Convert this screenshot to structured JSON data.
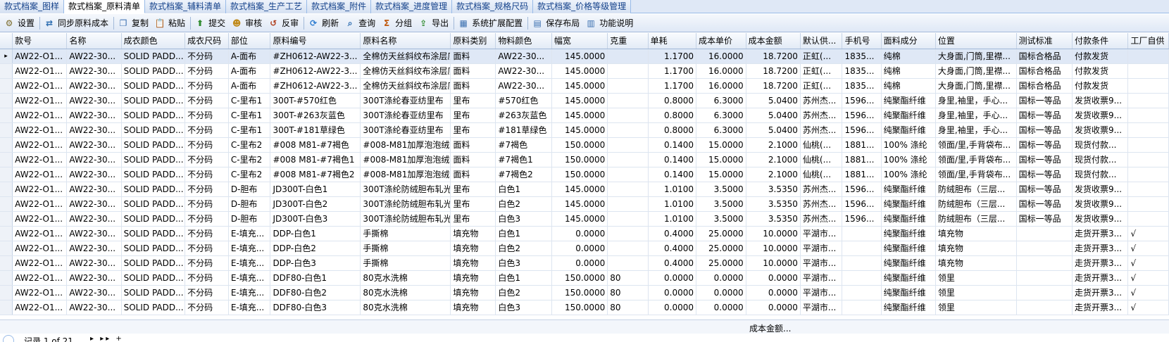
{
  "tabs": [
    {
      "label": "款式档案_图样",
      "active": false
    },
    {
      "label": "款式档案_原料清单",
      "active": true
    },
    {
      "label": "款式档案_辅料清单",
      "active": false
    },
    {
      "label": "款式档案_生产工艺",
      "active": false
    },
    {
      "label": "款式档案_附件",
      "active": false
    },
    {
      "label": "款式档案_进度管理",
      "active": false
    },
    {
      "label": "款式档案_规格尺码",
      "active": false
    },
    {
      "label": "款式档案_价格等级管理",
      "active": false
    }
  ],
  "toolbar": [
    {
      "label": "设置",
      "icon": "settings-icon",
      "glyph": "⚙",
      "color": "#7a6a2a"
    },
    {
      "label": "同步原料成本",
      "icon": "sync-cost-icon",
      "glyph": "⇄",
      "color": "#2b6cb0"
    },
    {
      "label": "复制",
      "icon": "copy-icon",
      "glyph": "❐",
      "color": "#3a6fb0"
    },
    {
      "label": "粘贴",
      "icon": "paste-icon",
      "glyph": "📋",
      "color": "#8a6d2b"
    },
    {
      "label": "提交",
      "icon": "submit-icon",
      "glyph": "⬆",
      "color": "#2f8a2f"
    },
    {
      "label": "审核",
      "icon": "approve-user-icon",
      "glyph": "☻",
      "color": "#c08a1a"
    },
    {
      "label": "反审",
      "icon": "unapprove-icon",
      "glyph": "↺",
      "color": "#b04020"
    },
    {
      "label": "刷新",
      "icon": "refresh-icon",
      "glyph": "⟳",
      "color": "#2b7bd0"
    },
    {
      "label": "查询",
      "icon": "search-icon",
      "glyph": "⌕",
      "color": "#2b6cb0"
    },
    {
      "label": "分组",
      "icon": "group-sigma-icon",
      "glyph": "Σ",
      "color": "#c05a10"
    },
    {
      "label": "导出",
      "icon": "export-icon",
      "glyph": "⇪",
      "color": "#2f8a2f"
    },
    {
      "label": "系统扩展配置",
      "icon": "extension-config-icon",
      "glyph": "▦",
      "color": "#3a6fb0"
    },
    {
      "label": "保存布局",
      "icon": "save-layout-icon",
      "glyph": "▤",
      "color": "#3a6fb0"
    },
    {
      "label": "功能说明",
      "icon": "help-doc-icon",
      "glyph": "▥",
      "color": "#3a6fb0"
    }
  ],
  "columns": [
    "款号",
    "名称",
    "成衣颜色",
    "成衣尺码",
    "部位",
    "原料编号",
    "原料名称",
    "原料类别",
    "物料颜色",
    "幅宽",
    "克重",
    "单耗",
    "成本单价",
    "成本金额",
    "默认供...",
    "手机号",
    "面料成分",
    "位置",
    "测试标准",
    "付款条件",
    "工厂自供"
  ],
  "rows": [
    [
      "AW22-O1...",
      "AW22-30...",
      "SOLID PADD...",
      "不分码",
      "A-面布",
      "#ZH0612-AW22-3...",
      "全棉仿天丝斜纹布涂层底",
      "面料",
      "AW22-30...",
      "145.0000",
      "",
      "1.1700",
      "16.0000",
      "18.7200",
      "正虹(...",
      "1835...",
      "纯棉",
      "大身面,门筒,里襟...",
      "国标合格品",
      "付款发货",
      ""
    ],
    [
      "AW22-O1...",
      "AW22-30...",
      "SOLID PADD...",
      "不分码",
      "A-面布",
      "#ZH0612-AW22-3...",
      "全棉仿天丝斜纹布涂层底",
      "面料",
      "AW22-30...",
      "145.0000",
      "",
      "1.1700",
      "16.0000",
      "18.7200",
      "正虹(...",
      "1835...",
      "纯棉",
      "大身面,门筒,里襟...",
      "国标合格品",
      "付款发货",
      ""
    ],
    [
      "AW22-O1...",
      "AW22-30...",
      "SOLID PADD...",
      "不分码",
      "A-面布",
      "#ZH0612-AW22-3...",
      "全棉仿天丝斜纹布涂层底",
      "面料",
      "AW22-30...",
      "145.0000",
      "",
      "1.1700",
      "16.0000",
      "18.7200",
      "正虹(...",
      "1835...",
      "纯棉",
      "大身面,门筒,里襟...",
      "国标合格品",
      "付款发货",
      ""
    ],
    [
      "AW22-O1...",
      "AW22-30...",
      "SOLID PADD...",
      "不分码",
      "C-里布1",
      "300T-#570红色",
      "300T涤纶春亚纺里布",
      "里布",
      "#570红色",
      "145.0000",
      "",
      "0.8000",
      "6.3000",
      "5.0400",
      "苏州杰...",
      "1596...",
      "纯聚酯纤维",
      "身里,袖里，手心...",
      "国标一等品",
      "发货收票9...",
      ""
    ],
    [
      "AW22-O1...",
      "AW22-30...",
      "SOLID PADD...",
      "不分码",
      "C-里布1",
      "300T-#263灰蓝色",
      "300T涤纶春亚纺里布",
      "里布",
      "#263灰蓝色",
      "145.0000",
      "",
      "0.8000",
      "6.3000",
      "5.0400",
      "苏州杰...",
      "1596...",
      "纯聚酯纤维",
      "身里,袖里，手心...",
      "国标一等品",
      "发货收票9...",
      ""
    ],
    [
      "AW22-O1...",
      "AW22-30...",
      "SOLID PADD...",
      "不分码",
      "C-里布1",
      "300T-#181草绿色",
      "300T涤纶春亚纺里布",
      "里布",
      "#181草绿色",
      "145.0000",
      "",
      "0.8000",
      "6.3000",
      "5.0400",
      "苏州杰...",
      "1596...",
      "纯聚酯纤维",
      "身里,袖里，手心...",
      "国标一等品",
      "发货收票9...",
      ""
    ],
    [
      "AW22-O1...",
      "AW22-30...",
      "SOLID PADD...",
      "不分码",
      "C-里布2",
      "#008 M81-#7褐色",
      "#008-M81加厚泡泡绒",
      "面料",
      "#7褐色",
      "150.0000",
      "",
      "0.1400",
      "15.0000",
      "2.1000",
      "仙桃(...",
      "1881...",
      "100% 涤纶",
      "领面/里,手背袋布...",
      "国标一等品",
      "现货付款...",
      ""
    ],
    [
      "AW22-O1...",
      "AW22-30...",
      "SOLID PADD...",
      "不分码",
      "C-里布2",
      "#008 M81-#7褐色1",
      "#008-M81加厚泡泡绒",
      "面料",
      "#7褐色1",
      "150.0000",
      "",
      "0.1400",
      "15.0000",
      "2.1000",
      "仙桃(...",
      "1881...",
      "100% 涤纶",
      "领面/里,手背袋布...",
      "国标一等品",
      "现货付款...",
      ""
    ],
    [
      "AW22-O1...",
      "AW22-30...",
      "SOLID PADD...",
      "不分码",
      "C-里布2",
      "#008 M81-#7褐色2",
      "#008-M81加厚泡泡绒",
      "面料",
      "#7褐色2",
      "150.0000",
      "",
      "0.1400",
      "15.0000",
      "2.1000",
      "仙桃(...",
      "1881...",
      "100% 涤纶",
      "领面/里,手背袋布...",
      "国标一等品",
      "现货付款...",
      ""
    ],
    [
      "AW22-O1...",
      "AW22-30...",
      "SOLID PADD...",
      "不分码",
      "D-胆布",
      "JD300T-白色1",
      "300T涤纶防绒胆布轧光底",
      "里布",
      "白色1",
      "145.0000",
      "",
      "1.0100",
      "3.5000",
      "3.5350",
      "苏州杰...",
      "1596...",
      "纯聚酯纤维",
      "防绒胆布（三层...",
      "国标一等品",
      "发货收票9...",
      ""
    ],
    [
      "AW22-O1...",
      "AW22-30...",
      "SOLID PADD...",
      "不分码",
      "D-胆布",
      "JD300T-白色2",
      "300T涤纶防绒胆布轧光底",
      "里布",
      "白色2",
      "145.0000",
      "",
      "1.0100",
      "3.5000",
      "3.5350",
      "苏州杰...",
      "1596...",
      "纯聚酯纤维",
      "防绒胆布（三层...",
      "国标一等品",
      "发货收票9...",
      ""
    ],
    [
      "AW22-O1...",
      "AW22-30...",
      "SOLID PADD...",
      "不分码",
      "D-胆布",
      "JD300T-白色3",
      "300T涤纶防绒胆布轧光底",
      "里布",
      "白色3",
      "145.0000",
      "",
      "1.0100",
      "3.5000",
      "3.5350",
      "苏州杰...",
      "1596...",
      "纯聚酯纤维",
      "防绒胆布（三层...",
      "国标一等品",
      "发货收票9...",
      ""
    ],
    [
      "AW22-O1...",
      "AW22-30...",
      "SOLID PADD...",
      "不分码",
      "E-填充...",
      "DDP-白色1",
      "手撕棉",
      "填充物",
      "白色1",
      "0.0000",
      "",
      "0.4000",
      "25.0000",
      "10.0000",
      "平湖市...",
      "",
      "纯聚酯纤维",
      "填充物",
      "",
      "走货开票3...",
      "√"
    ],
    [
      "AW22-O1...",
      "AW22-30...",
      "SOLID PADD...",
      "不分码",
      "E-填充...",
      "DDP-白色2",
      "手撕棉",
      "填充物",
      "白色2",
      "0.0000",
      "",
      "0.4000",
      "25.0000",
      "10.0000",
      "平湖市...",
      "",
      "纯聚酯纤维",
      "填充物",
      "",
      "走货开票3...",
      "√"
    ],
    [
      "AW22-O1...",
      "AW22-30...",
      "SOLID PADD...",
      "不分码",
      "E-填充...",
      "DDP-白色3",
      "手撕棉",
      "填充物",
      "白色3",
      "0.0000",
      "",
      "0.4000",
      "25.0000",
      "10.0000",
      "平湖市...",
      "",
      "纯聚酯纤维",
      "填充物",
      "",
      "走货开票3...",
      "√"
    ],
    [
      "AW22-O1...",
      "AW22-30...",
      "SOLID PADD...",
      "不分码",
      "E-填充...",
      "DDF80-白色1",
      "80克水洗棉",
      "填充物",
      "白色1",
      "150.0000",
      "80",
      "0.0000",
      "0.0000",
      "0.0000",
      "平湖市...",
      "",
      "纯聚酯纤维",
      "领里",
      "",
      "走货开票3...",
      "√"
    ],
    [
      "AW22-O1...",
      "AW22-30...",
      "SOLID PADD...",
      "不分码",
      "E-填充...",
      "DDF80-白色2",
      "80克水洗棉",
      "填充物",
      "白色2",
      "150.0000",
      "80",
      "0.0000",
      "0.0000",
      "0.0000",
      "平湖市...",
      "",
      "纯聚酯纤维",
      "领里",
      "",
      "走货开票3...",
      "√"
    ],
    [
      "AW22-O1...",
      "AW22-30...",
      "SOLID PADD...",
      "不分码",
      "E-填充...",
      "DDF80-白色3",
      "80克水洗棉",
      "填充物",
      "白色3",
      "150.0000",
      "80",
      "0.0000",
      "0.0000",
      "0.0000",
      "平湖市...",
      "",
      "纯聚酯纤维",
      "领里",
      "",
      "走货开票3...",
      "√"
    ]
  ],
  "selected_row": 0,
  "footer": {
    "summary": "成本金额..."
  },
  "navigator": {
    "record_text": "记录 1 of 21",
    "buttons": "▸ ▸▸ +"
  }
}
